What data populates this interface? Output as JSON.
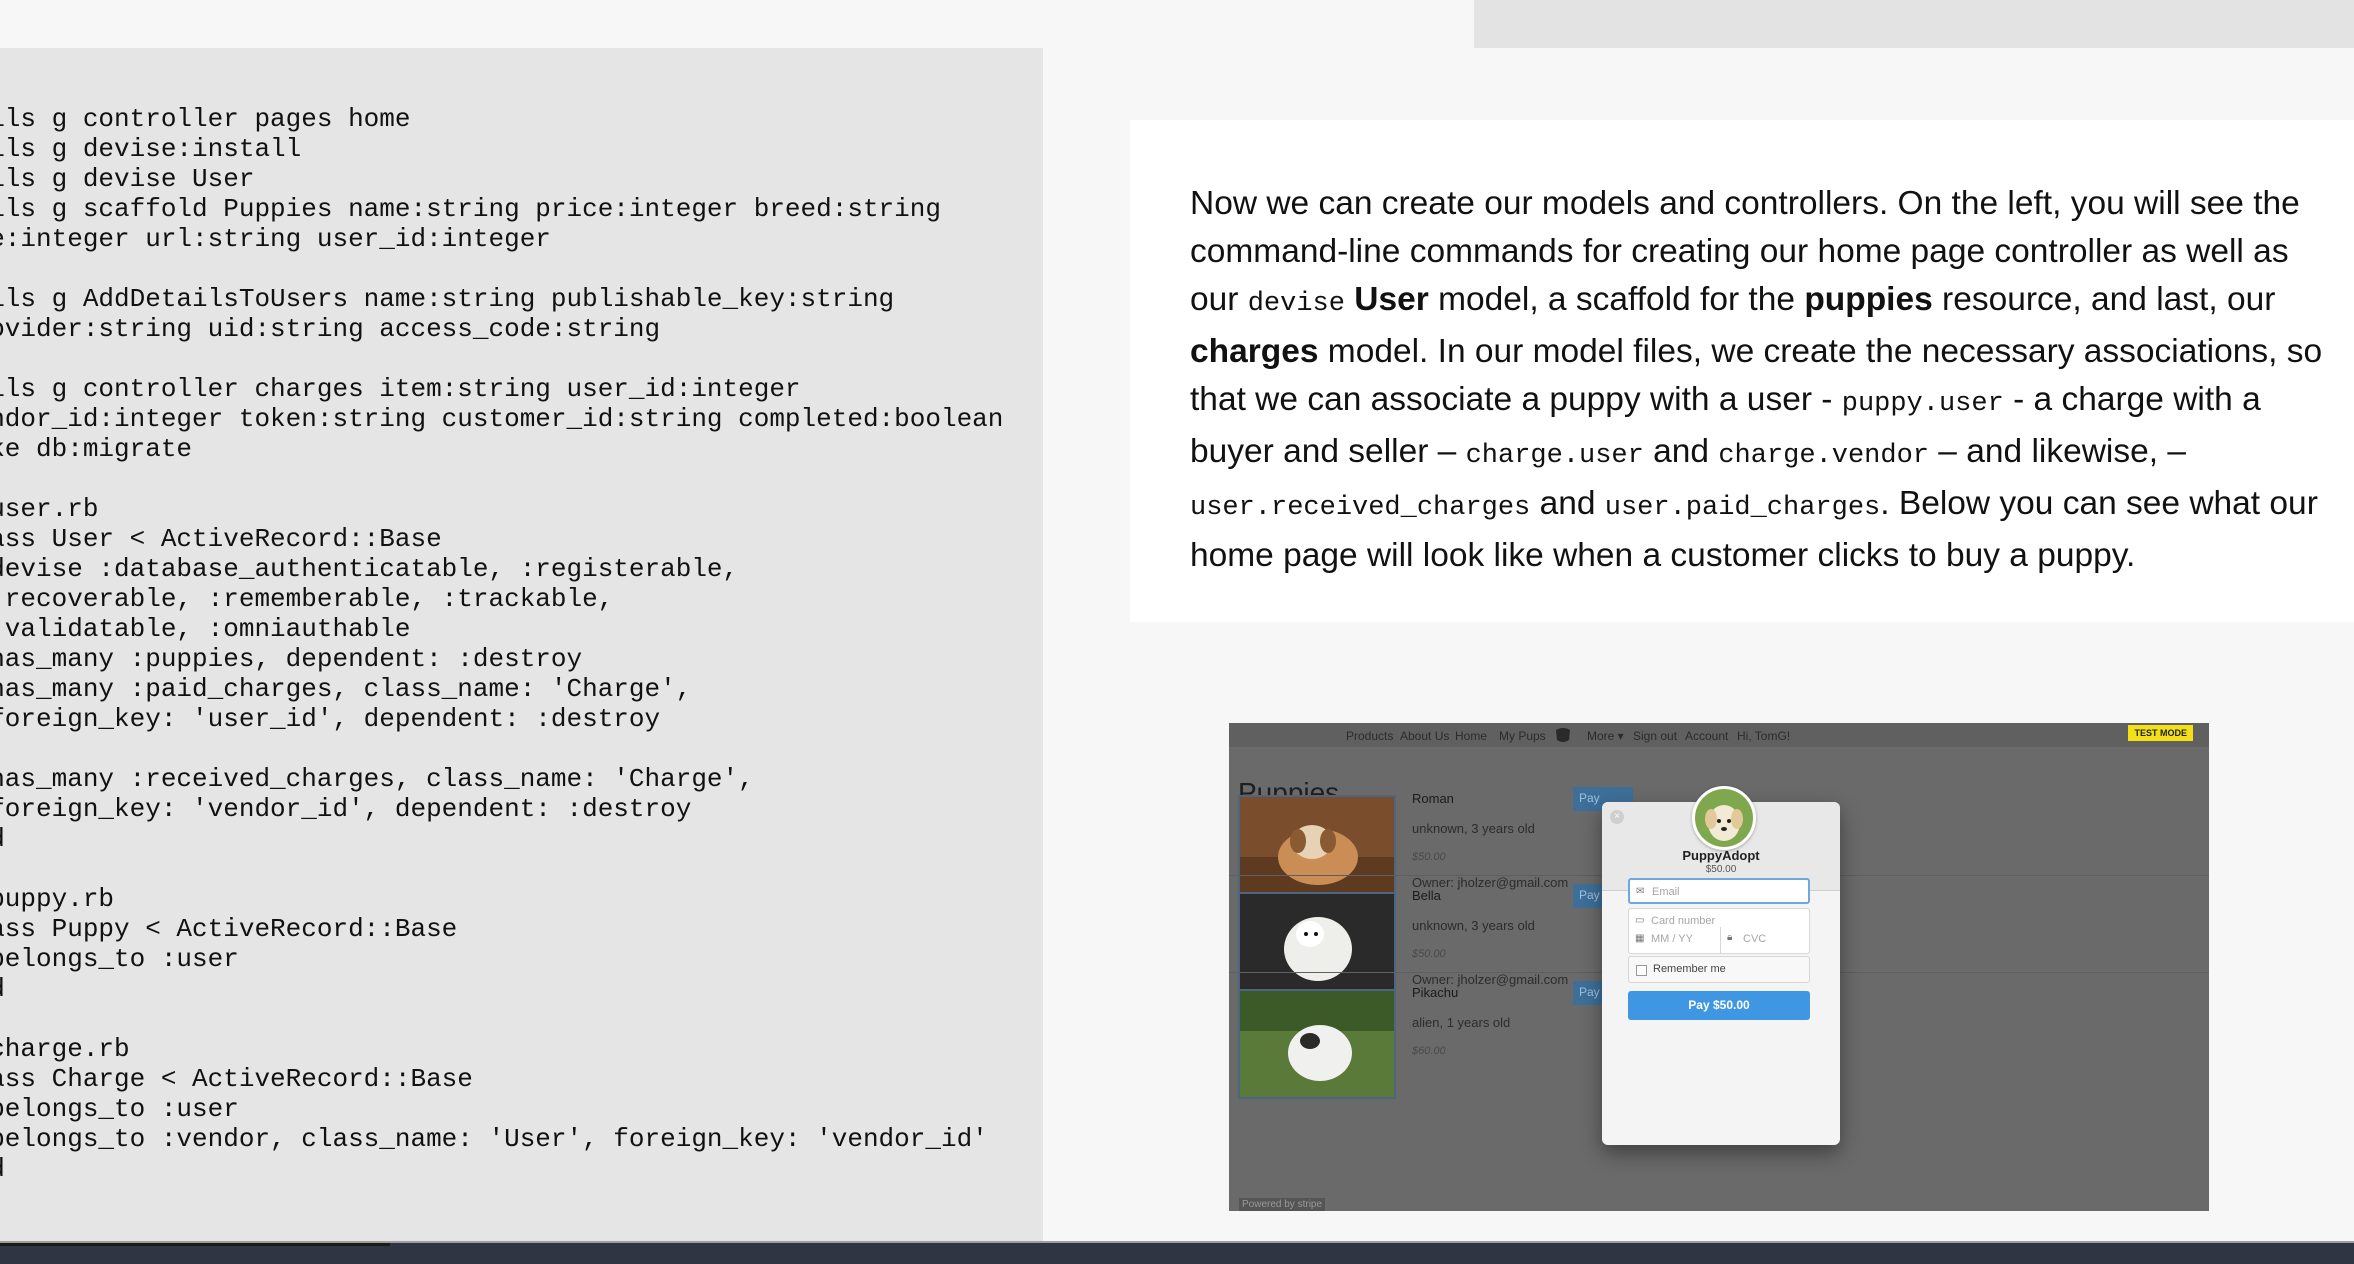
{
  "code": {
    "lines": [
      "rails g controller pages home",
      "rails g devise:install",
      "rails g devise User",
      "rails g scaffold Puppies name:string price:integer breed:string",
      "age:integer url:string user_id:integer",
      "",
      "rails g AddDetailsToUsers name:string publishable_key:string",
      "provider:string uid:string access_code:string",
      "",
      "rails g controller charges item:string user_id:integer",
      "vendor_id:integer token:string customer_id:string completed:boolean",
      "rake db:migrate",
      "",
      "# user.rb",
      "class User < ActiveRecord::Base",
      "  devise :database_authenticatable, :registerable,",
      "  :recoverable, :rememberable, :trackable,",
      "  :validatable, :omniauthable",
      "  has_many :puppies, dependent: :destroy",
      "  has_many :paid_charges, class_name: 'Charge',",
      "  foreign_key: 'user_id', dependent: :destroy",
      "",
      "  has_many :received_charges, class_name: 'Charge',",
      "  foreign_key: 'vendor_id', dependent: :destroy",
      "end",
      "",
      "# puppy.rb",
      "class Puppy < ActiveRecord::Base",
      "  belongs_to :user",
      "end",
      "",
      "# charge.rb",
      "class Charge < ActiveRecord::Base",
      "  belongs_to :user",
      "  belongs_to :vendor, class_name: 'User', foreign_key: 'vendor_id'",
      "end"
    ]
  },
  "description": {
    "t1": "Now we can create our models and controllers. On the left, you will see the command-line commands for creating our home page controller as well as our ",
    "c1": "devise",
    "b1": "User",
    "t2": " model, a scaffold for the ",
    "b2": "puppies",
    "t3": " resource, and last, our ",
    "b3": "charges",
    "t4": " model. In our model files, we create the necessary associations, so that we can associate a puppy with a user - ",
    "c2": "puppy.user",
    "t5": " - a charge with a buyer and seller – ",
    "c3": "charge.user",
    "t6": " and ",
    "c4": "charge.vendor",
    "t7": " – and likewise, – ",
    "c5": "user.received_charges",
    "t8": " and ",
    "c6": "user.paid_charges",
    "t9": ". Below you can see what our home page will look like when a customer clicks to buy a puppy."
  },
  "screenshot": {
    "nav": [
      "Products",
      "About Us",
      "Home",
      "My Pups",
      "More ▾",
      "Sign out",
      "Account",
      "Hi, TomG!"
    ],
    "test_mode": "TEST MODE",
    "title": "Puppies",
    "pay_stub": "Pay",
    "puppies": [
      {
        "name": "Roman",
        "desc": "unknown, 3 years old",
        "price": "$50.00",
        "owner": "Owner: jholzer@gmail.com"
      },
      {
        "name": "Bella",
        "desc": "unknown, 3 years old",
        "price": "$50.00",
        "owner": "Owner: jholzer@gmail.com"
      },
      {
        "name": "Pikachu",
        "desc": "alien, 1 years old",
        "price": "$60.00",
        "owner": ""
      }
    ],
    "scroll_label": "Powered by stripe",
    "modal": {
      "merchant": "PuppyAdopt",
      "amount": "$50.00",
      "email_placeholder": "Email",
      "card_placeholder": "Card number",
      "expiry_placeholder": "MM / YY",
      "cvc_placeholder": "CVC",
      "remember": "Remember me",
      "pay_label": "Pay $50.00",
      "close": "×"
    }
  },
  "colors": {
    "code_bg": "#e5e5e5",
    "page_bg": "#f7f7f7",
    "stripe_button": "#3f97e3",
    "test_mode": "#f3e017"
  }
}
